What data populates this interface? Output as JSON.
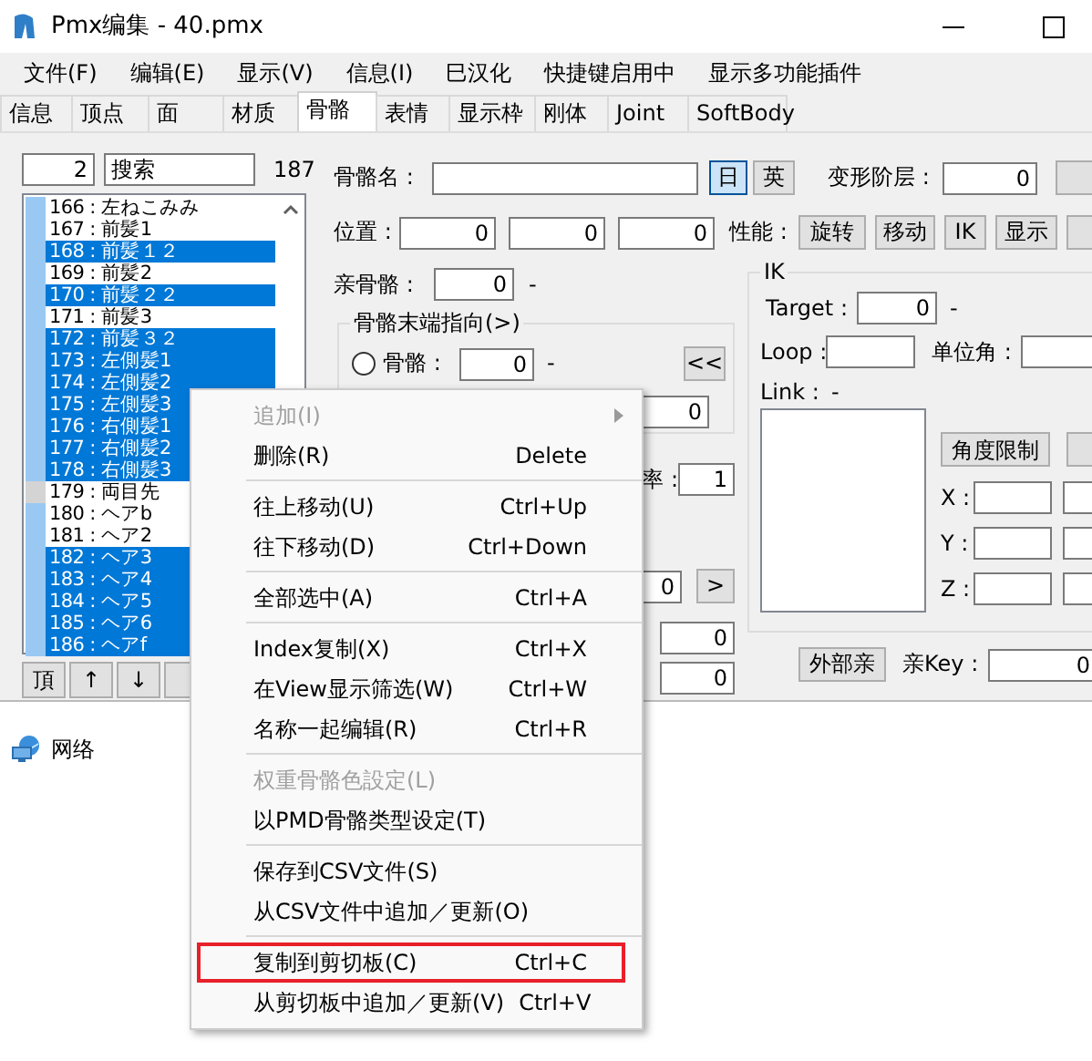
{
  "window": {
    "title": "Pmx编集 - 40.pmx"
  },
  "menu_bar": [
    "文件(F)",
    "编辑(E)",
    "显示(V)",
    "信息(I)",
    "巳汉化",
    "快捷键启用中",
    "显示多功能插件"
  ],
  "tabs": [
    {
      "label": "信息",
      "selected": false
    },
    {
      "label": "顶点",
      "selected": false
    },
    {
      "label": "面",
      "selected": false
    },
    {
      "label": "材质",
      "selected": false
    },
    {
      "label": "骨骼",
      "selected": true
    },
    {
      "label": "表情",
      "selected": false
    },
    {
      "label": "显示枠",
      "selected": false
    },
    {
      "label": "刚体",
      "selected": false
    },
    {
      "label": "Joint",
      "selected": false
    },
    {
      "label": "SoftBody",
      "selected": false
    }
  ],
  "bone_list": {
    "index_value": "2",
    "search_value": "搜索",
    "count": "187",
    "rows": [
      {
        "text": "166 : 左ねこみみ",
        "selected": false,
        "color": "#99c9f3"
      },
      {
        "text": "167 : 前髪1",
        "selected": false,
        "color": "#99c9f3"
      },
      {
        "text": "168 : 前髪１２",
        "selected": true,
        "color": "#99c9f3"
      },
      {
        "text": "169 : 前髪2",
        "selected": false,
        "color": "#99c9f3"
      },
      {
        "text": "170 : 前髪２２",
        "selected": true,
        "color": "#99c9f3"
      },
      {
        "text": "171 : 前髪3",
        "selected": false,
        "color": "#99c9f3"
      },
      {
        "text": "172 : 前髪３２",
        "selected": true,
        "color": "#99c9f3"
      },
      {
        "text": "173 : 左側髪1",
        "selected": true,
        "color": "#99c9f3"
      },
      {
        "text": "174 : 左側髪2",
        "selected": true,
        "color": "#99c9f3"
      },
      {
        "text": "175 : 左側髪3",
        "selected": true,
        "color": "#99c9f3"
      },
      {
        "text": "176 : 右側髪1",
        "selected": true,
        "color": "#99c9f3"
      },
      {
        "text": "177 : 右側髪2",
        "selected": true,
        "color": "#99c9f3"
      },
      {
        "text": "178 : 右側髪3",
        "selected": true,
        "color": "#99c9f3"
      },
      {
        "text": "179 : 両目先",
        "selected": false,
        "color": "#d4d4d4"
      },
      {
        "text": "180 : ヘアb",
        "selected": false,
        "color": "#99c9f3"
      },
      {
        "text": "181 : ヘア2",
        "selected": false,
        "color": "#99c9f3"
      },
      {
        "text": "182 : ヘア3",
        "selected": true,
        "color": "#99c9f3"
      },
      {
        "text": "183 : ヘア4",
        "selected": true,
        "color": "#99c9f3"
      },
      {
        "text": "184 : ヘア5",
        "selected": true,
        "color": "#99c9f3"
      },
      {
        "text": "185 : ヘア6",
        "selected": true,
        "color": "#99c9f3"
      },
      {
        "text": "186 : ヘアf",
        "selected": true,
        "color": "#99c9f3"
      }
    ],
    "buttons": [
      "頂",
      "↑",
      "↓"
    ]
  },
  "bone_form": {
    "name_label": "骨骼名 :",
    "lang_buttons": [
      {
        "label": "日",
        "selected": true
      },
      {
        "label": "英",
        "selected": false
      }
    ],
    "deform_label": "变形阶层 :",
    "deform_value": "0",
    "position_label": "位置 :",
    "position_values": [
      "0",
      "0",
      "0"
    ],
    "flags_label": "性能 :",
    "flag_buttons": [
      "旋转",
      "移动",
      "IK",
      "显示"
    ],
    "parent_label": "亲骨骼 :",
    "parent_value": "0",
    "parent_name": "-",
    "tail_group": {
      "title": "骨骼末端指向(>)",
      "radios": [
        {
          "label": "骨骼 :",
          "selected": false
        }
      ],
      "bone_value": "0",
      "bone_name": "-",
      "back_button": "<<",
      "offset_value": "0"
    },
    "rate_label": "率 :",
    "rate_value": "1",
    "lower_value": "0",
    "next_button": ">",
    "extra_values": [
      "0",
      "0"
    ]
  },
  "ik": {
    "title": "IK",
    "target_label": "Target :",
    "target_value": "0",
    "target_name": "-",
    "loop_label": "Loop :",
    "unit_angle_label": "单位角 :",
    "link_label": "Link :",
    "link_name": "-",
    "angle_limit_button": "角度限制",
    "axis_labels": [
      "X :",
      "Y :",
      "Z :"
    ]
  },
  "external_parent_button": "外部亲",
  "parent_key_label": "亲Key :",
  "parent_key_value": "0",
  "desktop": {
    "items": [
      {
        "label": "网络"
      }
    ]
  },
  "context_menu": {
    "items": [
      {
        "kind": "item",
        "label": "追加(I)",
        "disabled": true,
        "submenu": true,
        "highlighted": false
      },
      {
        "kind": "item",
        "label": "删除(R)",
        "shortcut": "Delete",
        "disabled": false,
        "submenu": false,
        "highlighted": false
      },
      {
        "kind": "separator"
      },
      {
        "kind": "item",
        "label": "往上移动(U)",
        "shortcut": "Ctrl+Up",
        "disabled": false,
        "submenu": false,
        "highlighted": false
      },
      {
        "kind": "item",
        "label": "往下移动(D)",
        "shortcut": "Ctrl+Down",
        "disabled": false,
        "submenu": false,
        "highlighted": false
      },
      {
        "kind": "separator"
      },
      {
        "kind": "item",
        "label": "全部选中(A)",
        "shortcut": "Ctrl+A",
        "disabled": false,
        "submenu": false,
        "highlighted": false
      },
      {
        "kind": "separator"
      },
      {
        "kind": "item",
        "label": "Index复制(X)",
        "shortcut": "Ctrl+X",
        "disabled": false,
        "submenu": false,
        "highlighted": false
      },
      {
        "kind": "item",
        "label": "在View显示筛选(W)",
        "shortcut": "Ctrl+W",
        "disabled": false,
        "submenu": false,
        "highlighted": false
      },
      {
        "kind": "item",
        "label": "名称一起编辑(R)",
        "shortcut": "Ctrl+R",
        "disabled": false,
        "submenu": false,
        "highlighted": false
      },
      {
        "kind": "separator"
      },
      {
        "kind": "item",
        "label": "权重骨骼色設定(L)",
        "disabled": true,
        "submenu": false,
        "highlighted": false
      },
      {
        "kind": "item",
        "label": "以PMD骨骼类型设定(T)",
        "disabled": false,
        "submenu": false,
        "highlighted": false
      },
      {
        "kind": "separator"
      },
      {
        "kind": "item",
        "label": "保存到CSV文件(S)",
        "disabled": false,
        "submenu": false,
        "highlighted": false
      },
      {
        "kind": "item",
        "label": "从CSV文件中追加／更新(O)",
        "disabled": false,
        "submenu": false,
        "highlighted": false
      },
      {
        "kind": "separator"
      },
      {
        "kind": "item",
        "label": "复制到剪切板(C)",
        "shortcut": "Ctrl+C",
        "disabled": false,
        "submenu": false,
        "highlighted": true
      },
      {
        "kind": "item",
        "label": "从剪切板中追加／更新(V)",
        "shortcut": "Ctrl+V",
        "disabled": false,
        "submenu": false,
        "highlighted": false
      }
    ]
  }
}
